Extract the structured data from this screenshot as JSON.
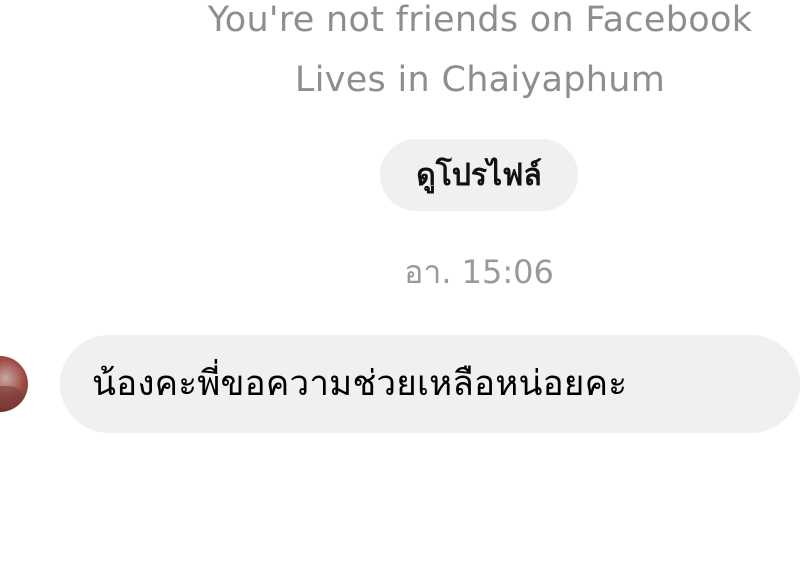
{
  "profile_card": {
    "friend_status": "You're not friends on Facebook",
    "location": "Lives in Chaiyaphum",
    "view_profile_label": "ดูโปรไฟล์"
  },
  "conversation": {
    "timestamp": "อา. 15:06",
    "messages": [
      {
        "text": "น้องคะพี่ขอความช่วยเหลือหน่อยคะ"
      }
    ]
  },
  "colors": {
    "background": "#ffffff",
    "bubble": "#f0f0f0",
    "muted_text": "#8e8e8e",
    "message_text": "#000000"
  }
}
